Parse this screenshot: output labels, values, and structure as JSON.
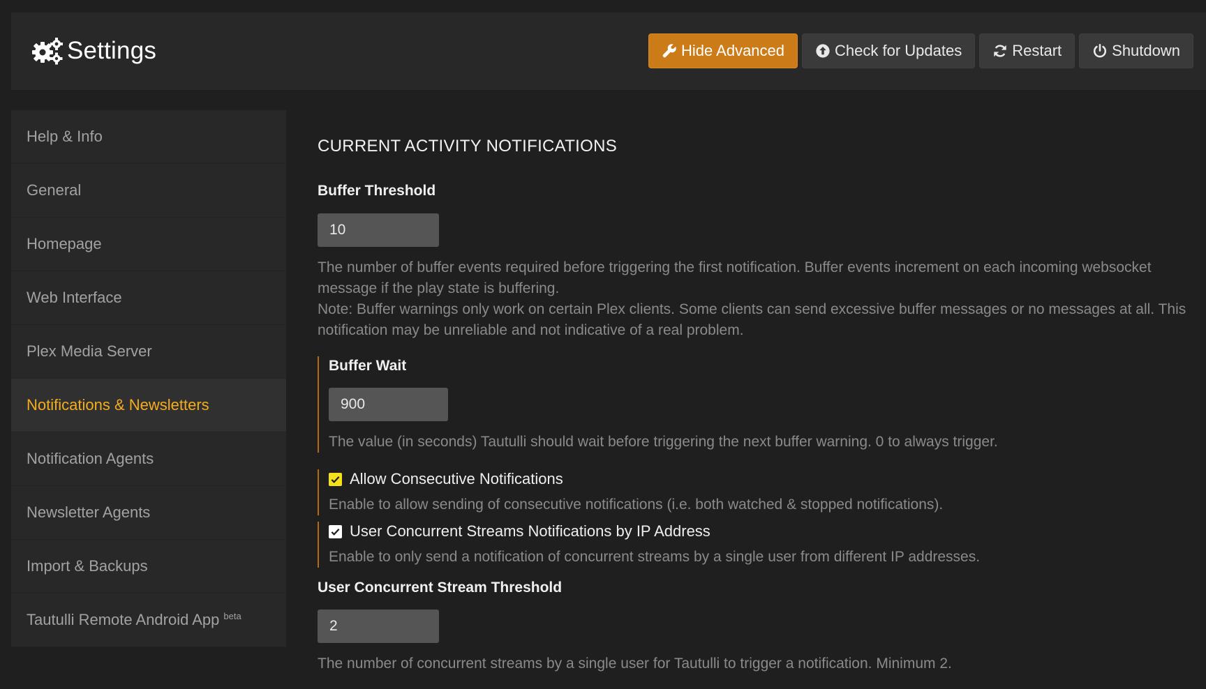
{
  "header": {
    "title": "Settings",
    "icon": "gears-icon",
    "buttons": [
      {
        "label": "Hide Advanced",
        "icon": "wrench-icon"
      },
      {
        "label": "Check for Updates",
        "icon": "arrow-up-circle-icon"
      },
      {
        "label": "Restart",
        "icon": "refresh-icon"
      },
      {
        "label": "Shutdown",
        "icon": "power-icon"
      }
    ],
    "accent_color": "#cc7b19"
  },
  "sidebar": {
    "items": [
      {
        "label": "Help & Info"
      },
      {
        "label": "General"
      },
      {
        "label": "Homepage"
      },
      {
        "label": "Web Interface"
      },
      {
        "label": "Plex Media Server"
      },
      {
        "label": "Notifications & Newsletters",
        "active": true
      },
      {
        "label": "Notification Agents"
      },
      {
        "label": "Newsletter Agents"
      },
      {
        "label": "Import & Backups"
      },
      {
        "label": "Tautulli Remote Android App",
        "badge": "beta"
      }
    ],
    "active_color": "#f4ad1f"
  },
  "main": {
    "section_title": "Current Activity Notifications",
    "buffer_threshold": {
      "label": "Buffer Threshold",
      "value": "10",
      "help_1": "The number of buffer events required before triggering the first notification. Buffer events increment on each incoming websocket message if the play state is buffering.",
      "help_2": "Note: Buffer warnings only work on certain Plex clients. Some clients can send excessive buffer messages or no messages at all. This notification may be unreliable and not indicative of a real problem."
    },
    "buffer_wait": {
      "label": "Buffer Wait",
      "value": "900",
      "help": "The value (in seconds) Tautulli should wait before triggering the next buffer warning. 0 to always trigger."
    },
    "allow_consecutive": {
      "label": "Allow Consecutive Notifications",
      "checked": true,
      "help": "Enable to allow sending of consecutive notifications (i.e. both watched & stopped notifications)."
    },
    "concurrent_by_ip": {
      "label": "User Concurrent Streams Notifications by IP Address",
      "checked": true,
      "help": "Enable to only send a notification of concurrent streams by a single user from different IP addresses."
    },
    "concurrent_threshold": {
      "label": "User Concurrent Stream Threshold",
      "value": "2",
      "help": "The number of concurrent streams by a single user for Tautulli to trigger a notification. Minimum 2."
    }
  }
}
